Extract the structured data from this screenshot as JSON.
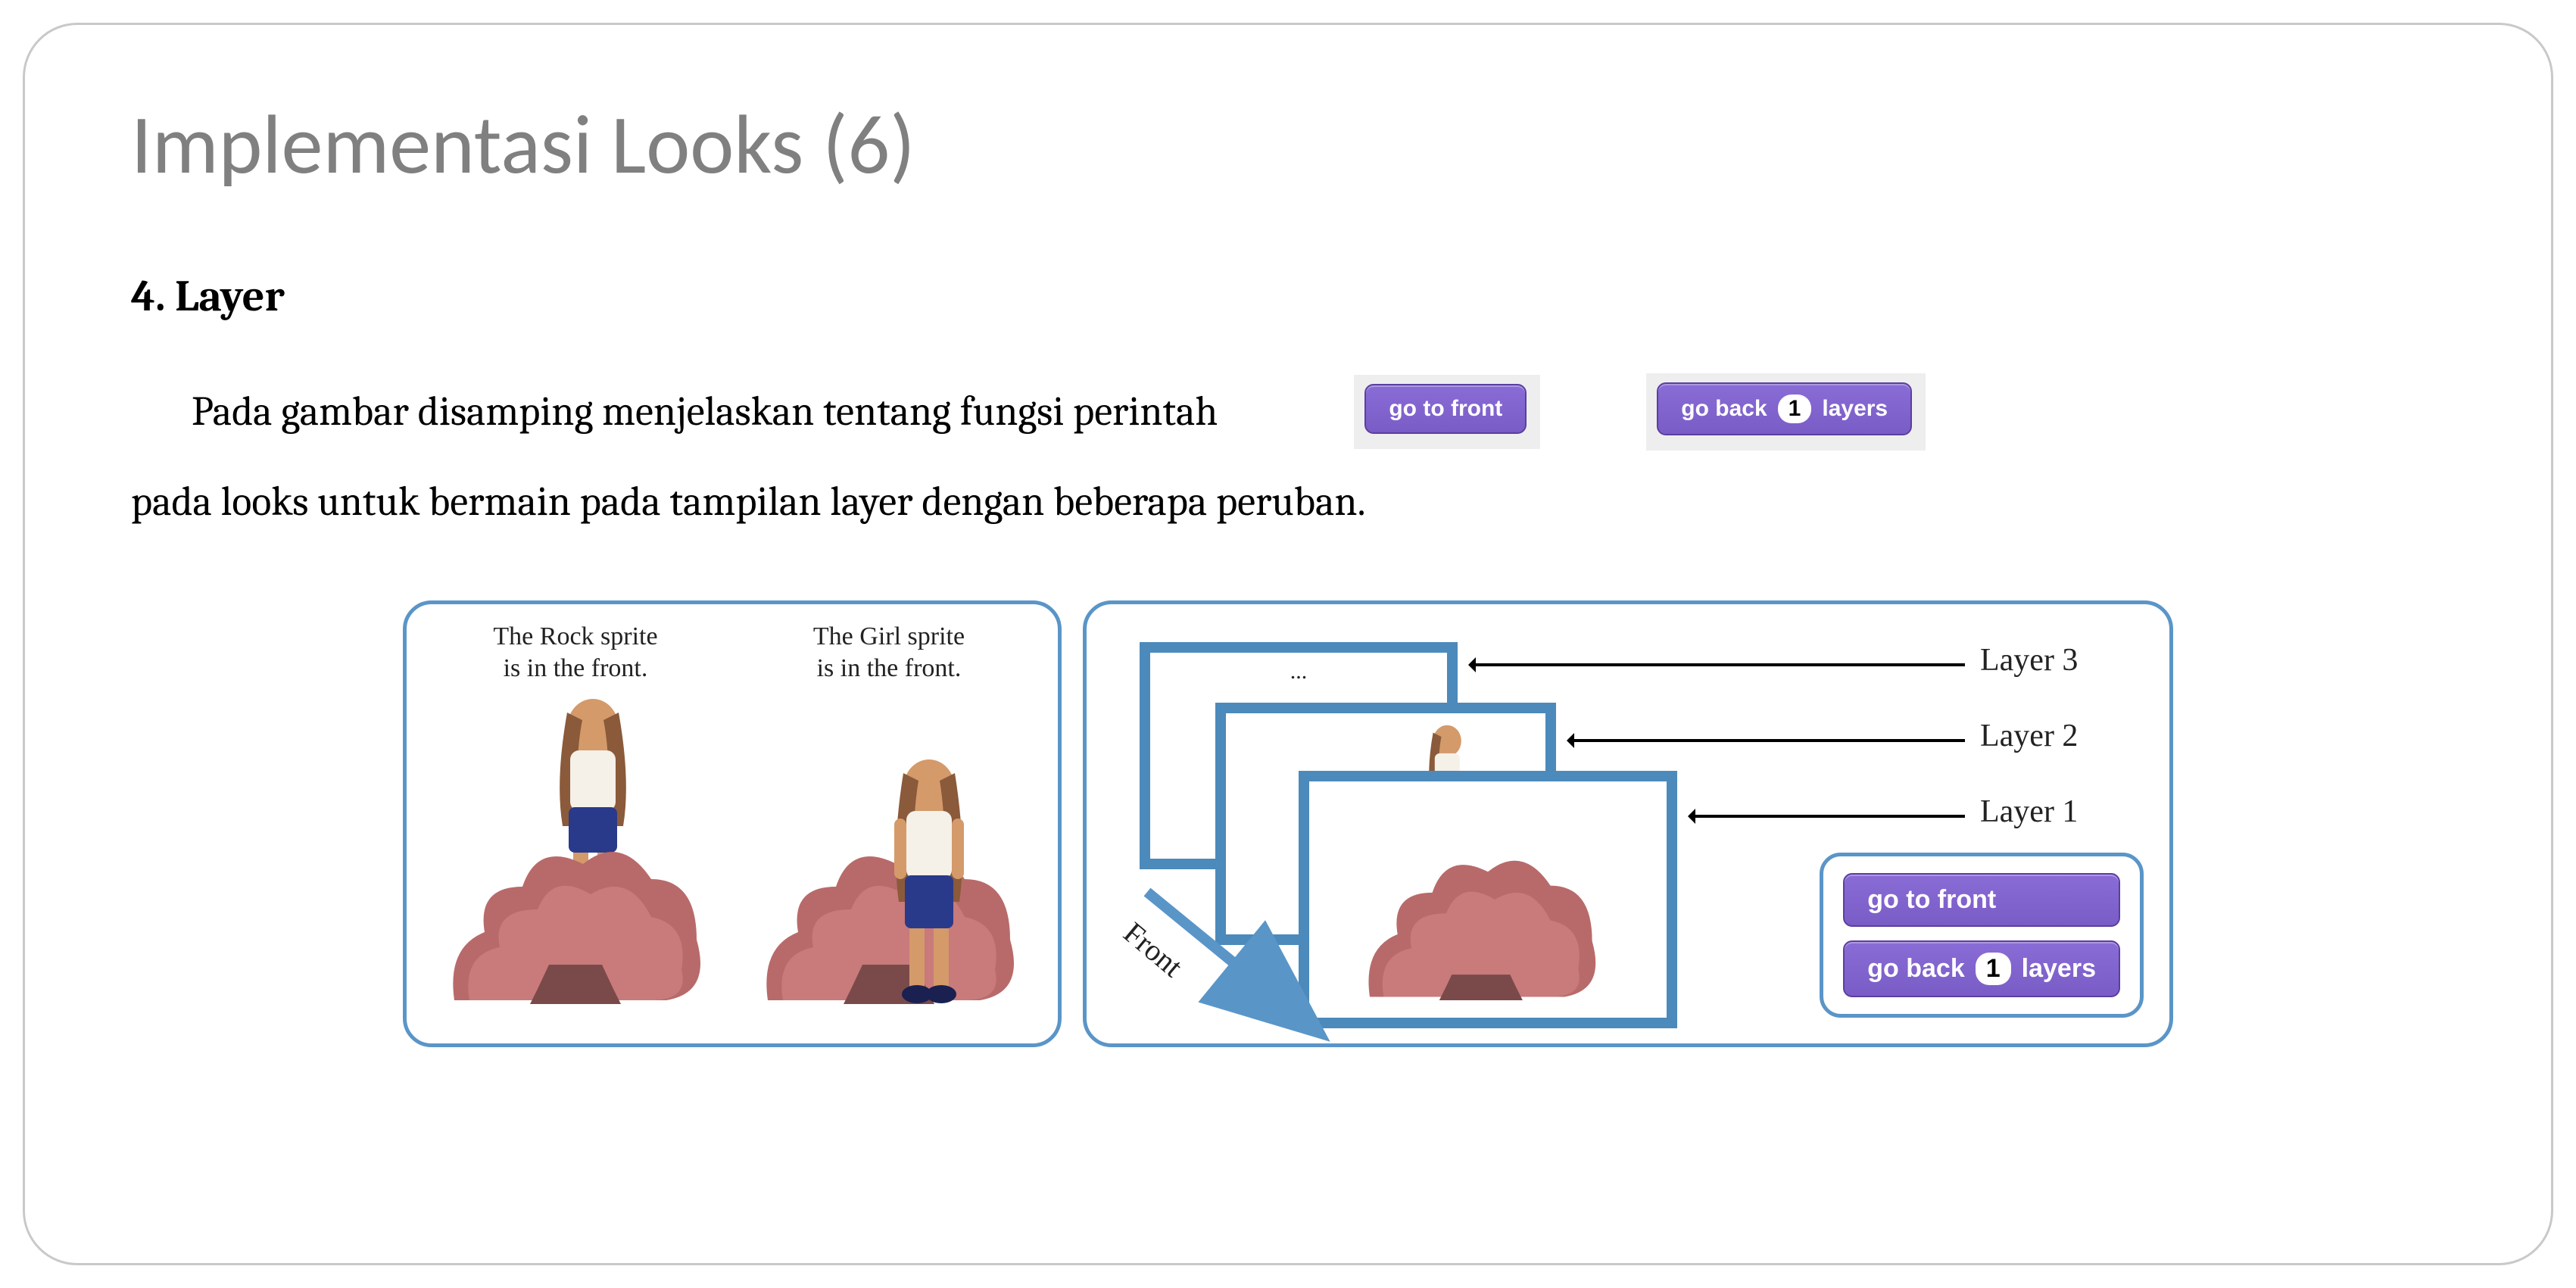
{
  "title": "Implementasi Looks (6)",
  "section": {
    "heading": "4. Layer"
  },
  "text": {
    "line1": "Pada gambar disamping menjelaskan tentang fungsi perintah",
    "line2": "pada looks untuk bermain pada tampilan layer dengan beberapa peruban."
  },
  "blocks": {
    "go_to_front": "go to front",
    "go_back_prefix": "go back",
    "go_back_value": "1",
    "go_back_suffix": "layers"
  },
  "panels": {
    "left": {
      "caption_rock_l1": "The Rock sprite",
      "caption_rock_l2": "is in the front.",
      "caption_girl_l1": "The Girl sprite",
      "caption_girl_l2": "is in the front."
    },
    "right": {
      "dots": "...",
      "front_label": "Front",
      "layer3": "Layer 3",
      "layer2": "Layer 2",
      "layer1": "Layer 1"
    }
  },
  "icons": {
    "rock": "rock-sprite",
    "girl": "girl-sprite"
  },
  "colors": {
    "block_purple": "#8a6cd6",
    "panel_border": "#5a95c8",
    "title_gray": "#808080"
  }
}
